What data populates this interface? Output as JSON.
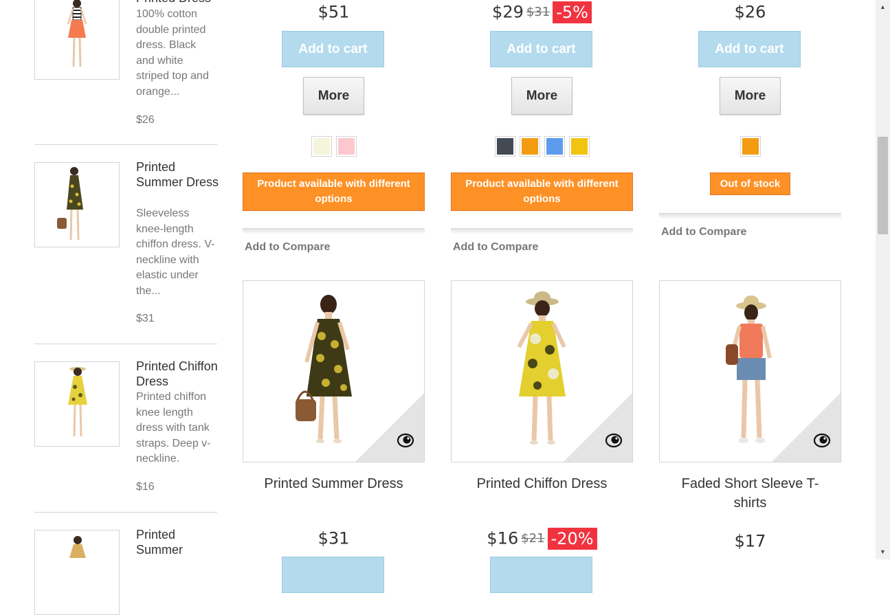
{
  "colors": {
    "cart_button": "#b3daed",
    "availability_badge": "#fe9126",
    "discount_badge": "#f13340"
  },
  "sidebar": {
    "items": [
      {
        "name": "Printed Dress",
        "description": "100% cotton double printed dress. Black and white striped top and orange...",
        "price": "$26",
        "image": "woman-striped-top-orange-skirt"
      },
      {
        "name": "Printed Summer Dress",
        "description": "Sleeveless knee-length chiffon dress. V-neckline with elastic under the...",
        "price": "$31",
        "image": "woman-dark-floral-dress"
      },
      {
        "name": "Printed Chiffon Dress",
        "description": "Printed chiffon knee length dress with tank straps. Deep v-neckline.",
        "price": "$16",
        "image": "woman-yellow-floral-dress"
      },
      {
        "name": "Printed Summer",
        "description": "",
        "price": "",
        "image": "woman-dress"
      }
    ]
  },
  "grid_top": [
    {
      "price": "$51",
      "old_price": "",
      "discount": "",
      "add_to_cart": "Add to cart",
      "more": "More",
      "swatches": [
        "#f5f5dc",
        "#fcc8cd"
      ],
      "availability": "Product available with different options",
      "compare": "Add to Compare"
    },
    {
      "price": "$29",
      "old_price": "$31",
      "discount": "-5%",
      "add_to_cart": "Add to cart",
      "more": "More",
      "swatches": [
        "#434a54",
        "#f39c11",
        "#5d9cec",
        "#f1c40f"
      ],
      "availability": "Product available with different options",
      "compare": "Add to Compare"
    },
    {
      "price": "$26",
      "old_price": "",
      "discount": "",
      "add_to_cart": "Add to cart",
      "more": "More",
      "swatches": [
        "#f39c11"
      ],
      "availability": "Out of stock",
      "compare": "Add to Compare"
    }
  ],
  "grid_bottom": [
    {
      "name": "Printed Summer Dress",
      "price": "$31",
      "old_price": "",
      "discount": "",
      "image": "woman-dark-floral-dress-handbag"
    },
    {
      "name": "Printed Chiffon Dress",
      "price": "$16",
      "old_price": "$21",
      "discount": "-20%",
      "image": "woman-yellow-floral-dress-hat"
    },
    {
      "name": "Faded Short Sleeve T-shirts",
      "price": "$17",
      "old_price": "",
      "discount": "",
      "image": "woman-orange-tshirt-denim-shorts"
    }
  ],
  "quick_view_icon": "eye-icon"
}
